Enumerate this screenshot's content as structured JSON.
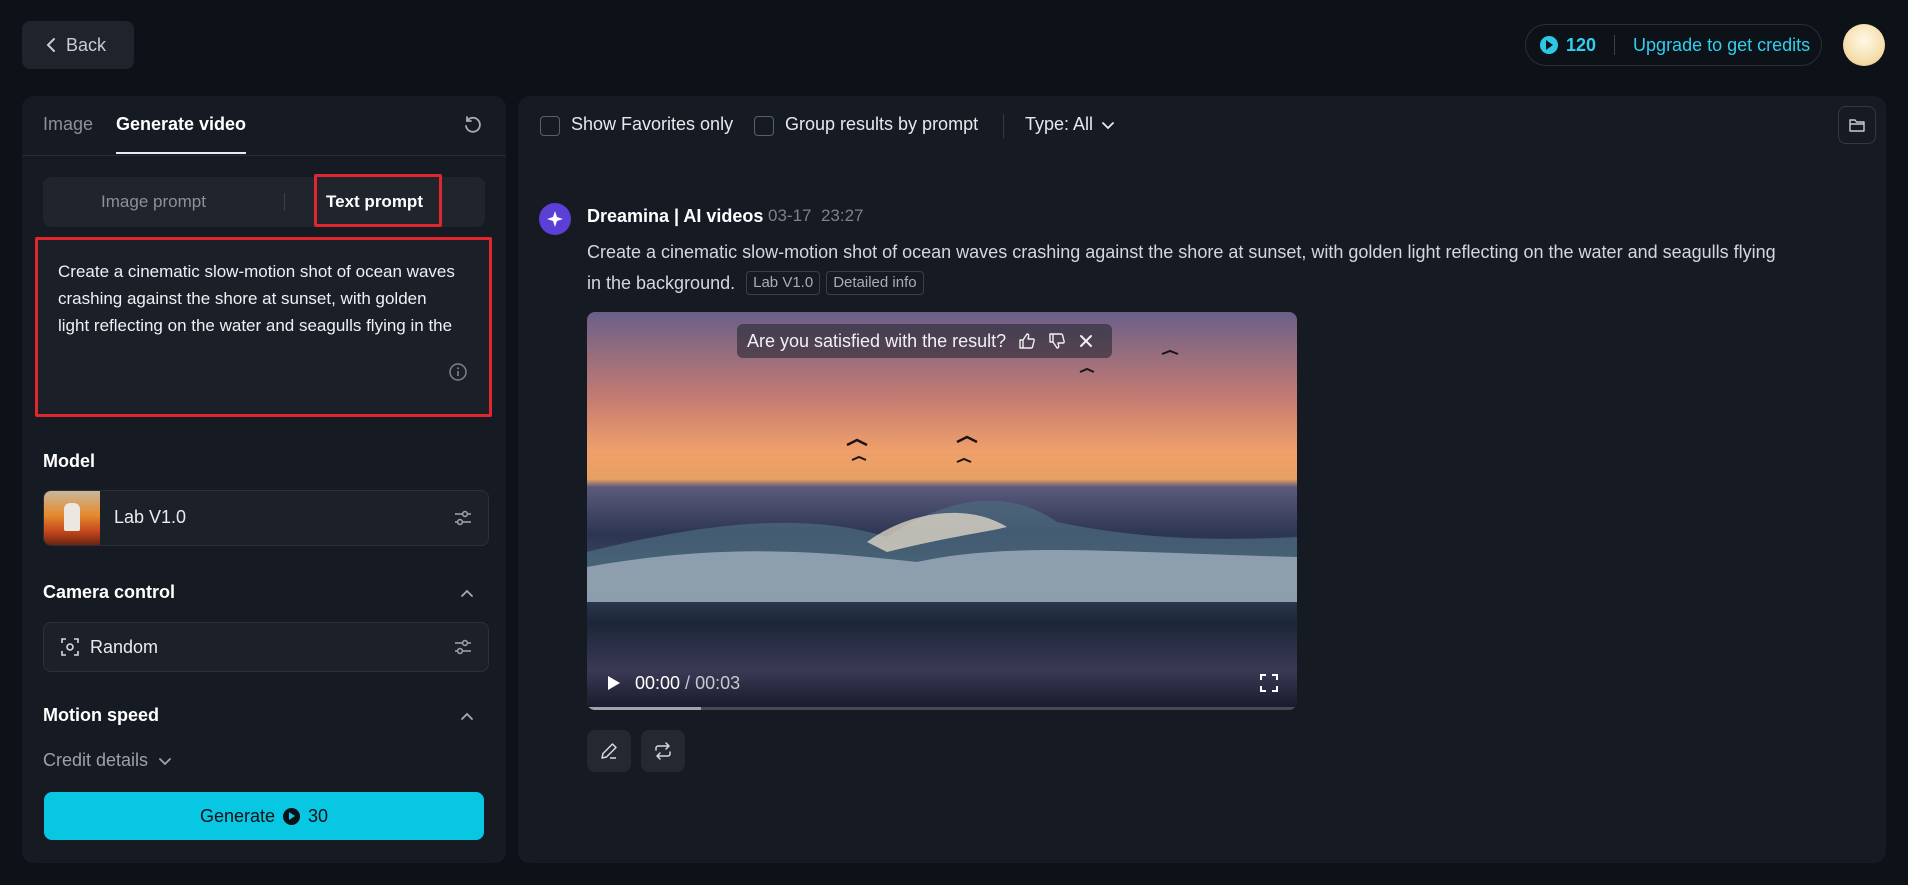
{
  "header": {
    "back_label": "Back",
    "credits": "120",
    "upgrade_label": "Upgrade to get credits"
  },
  "left_panel": {
    "tabs": [
      {
        "label": "Image",
        "active": false
      },
      {
        "label": "Generate video",
        "active": true
      }
    ],
    "prompt_modes": [
      {
        "label": "Image prompt",
        "active": false
      },
      {
        "label": "Text prompt",
        "active": true
      }
    ],
    "prompt_text": "Create a cinematic slow-motion shot of ocean waves crashing against the shore at sunset, with golden light reflecting on the water and seagulls flying in the background.",
    "model": {
      "label": "Model",
      "name": "Lab V1.0"
    },
    "camera_control": {
      "label": "Camera control",
      "value": "Random"
    },
    "motion_speed": {
      "label": "Motion speed"
    },
    "credit_details_label": "Credit details",
    "generate": {
      "label": "Generate",
      "cost": "30"
    }
  },
  "right_panel": {
    "filters": {
      "favorites_label": "Show Favorites only",
      "group_label": "Group results by prompt",
      "type_label": "Type: All"
    },
    "result": {
      "source": "Dreamina | AI videos",
      "date": "03-17",
      "time": "23:27",
      "prompt": "Create a cinematic slow-motion shot of ocean waves crashing against the shore at sunset, with golden light reflecting on the water and seagulls flying in the background.",
      "tags": [
        "Lab V1.0",
        "Detailed info"
      ],
      "video": {
        "feedback_question": "Are you satisfied with the result?",
        "current_time": "00:00",
        "duration": "00:03",
        "progress_fraction": 0.16
      }
    }
  },
  "colors": {
    "accent": "#08c7e2",
    "highlight": "#e0262e",
    "panel": "#161b23",
    "background": "#0d1118"
  }
}
